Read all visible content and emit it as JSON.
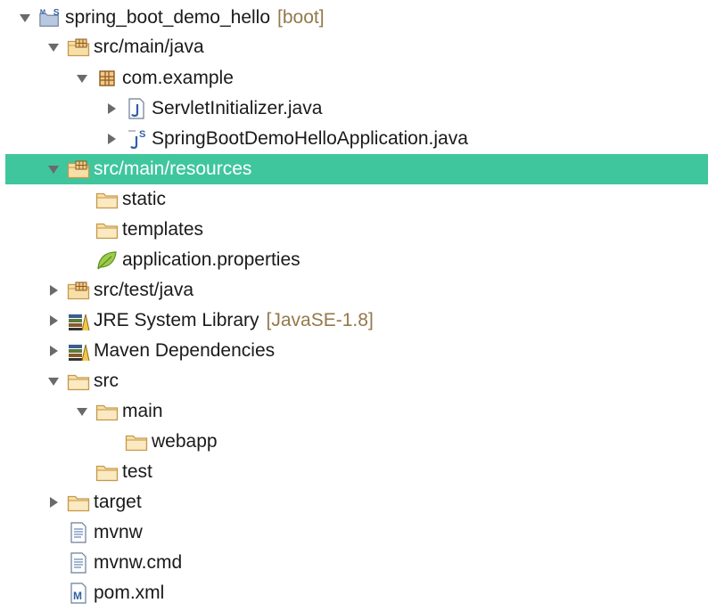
{
  "tree": {
    "project": {
      "label": "spring_boot_demo_hello",
      "decoration": "[boot]",
      "icon": "maven-spring-project-icon"
    },
    "src_main_java": {
      "label": "src/main/java",
      "icon": "source-folder-icon"
    },
    "com_example": {
      "label": "com.example",
      "icon": "package-icon"
    },
    "servlet_initializer": {
      "label": "ServletInitializer.java",
      "icon": "java-file-icon"
    },
    "app_class": {
      "label": "SpringBootDemoHelloApplication.java",
      "icon": "spring-java-file-icon"
    },
    "src_main_resources": {
      "label": "src/main/resources",
      "icon": "source-folder-icon",
      "selected": true
    },
    "static": {
      "label": "static",
      "icon": "folder-icon"
    },
    "templates": {
      "label": "templates",
      "icon": "folder-icon"
    },
    "app_properties": {
      "label": "application.properties",
      "icon": "spring-leaf-icon"
    },
    "src_test_java": {
      "label": "src/test/java",
      "icon": "source-folder-icon"
    },
    "jre_library": {
      "label": "JRE System Library",
      "decoration": "[JavaSE-1.8]",
      "icon": "library-icon"
    },
    "maven_deps": {
      "label": "Maven Dependencies",
      "icon": "library-icon"
    },
    "src": {
      "label": "src",
      "icon": "folder-icon"
    },
    "main": {
      "label": "main",
      "icon": "folder-icon"
    },
    "webapp": {
      "label": "webapp",
      "icon": "folder-icon"
    },
    "test": {
      "label": "test",
      "icon": "folder-icon"
    },
    "target": {
      "label": "target",
      "icon": "folder-icon"
    },
    "mvnw": {
      "label": "mvnw",
      "icon": "text-file-icon"
    },
    "mvnw_cmd": {
      "label": "mvnw.cmd",
      "icon": "text-file-icon"
    },
    "pom": {
      "label": "pom.xml",
      "icon": "maven-pom-icon"
    }
  },
  "colors": {
    "selection": "#3fc69d",
    "decoration": "#93794a",
    "folder_fill": "#f8dfa8",
    "folder_stroke": "#c49a4d",
    "java_blue": "#2f5fa8"
  }
}
